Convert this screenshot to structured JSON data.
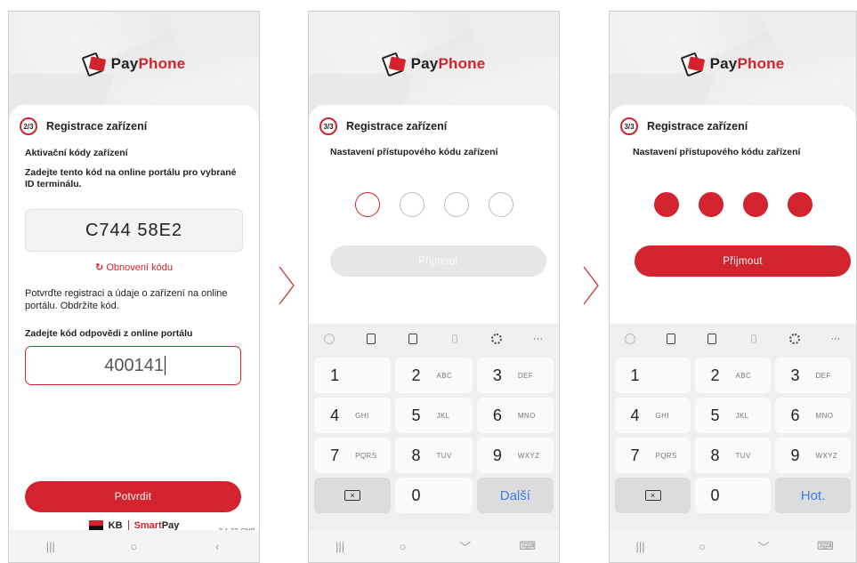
{
  "brand": {
    "name_pay": "Pay",
    "name_phone": "Phone"
  },
  "screen1": {
    "step": "2/3",
    "title": "Registrace zařízení",
    "section_title": "Aktivační kódy zařízení",
    "instruction": "Zadejte tento kód na online portálu pro vybrané ID terminálu.",
    "activation_code": "C744 58E2",
    "refresh_label": "Obnovení kódu",
    "confirm_text": "Potvrďte registraci a údaje o zařízení na online portálu. Obdržíte kód.",
    "response_label": "Zadejte kód odpovědi z online portálu",
    "response_value": "400141",
    "confirm_button": "Potvrdit",
    "footer_kb": "KB",
    "footer_smart": "Smart",
    "footer_pay": "Pay",
    "version": "2.1.32-SNB"
  },
  "screen2": {
    "step": "3/3",
    "title": "Registrace zařízení",
    "pin_title": "Nastavení přístupového kódu zařízení",
    "accept_button": "Přijmout",
    "action_key": "Další",
    "pins_filled": 0
  },
  "screen3": {
    "step": "3/3",
    "title": "Registrace zařízení",
    "pin_title": "Nastavení přístupového kódu zařízení",
    "accept_button": "Přijmout",
    "action_key": "Hot.",
    "pins_filled": 4
  },
  "keypad": {
    "k1": {
      "num": "1",
      "letters": ""
    },
    "k2": {
      "num": "2",
      "letters": "ABC"
    },
    "k3": {
      "num": "3",
      "letters": "DEF"
    },
    "k4": {
      "num": "4",
      "letters": "GHI"
    },
    "k5": {
      "num": "5",
      "letters": "JKL"
    },
    "k6": {
      "num": "6",
      "letters": "MNO"
    },
    "k7": {
      "num": "7",
      "letters": "PQRS"
    },
    "k8": {
      "num": "8",
      "letters": "TUV"
    },
    "k9": {
      "num": "9",
      "letters": "WXYZ"
    },
    "k0": {
      "num": "0",
      "letters": ""
    },
    "more": "···"
  },
  "nav": {
    "recent": "|||",
    "home": "○",
    "back": "‹",
    "hide": "﹀"
  },
  "colors": {
    "accent": "#d2232e",
    "action_blue": "#3d7ff0"
  }
}
